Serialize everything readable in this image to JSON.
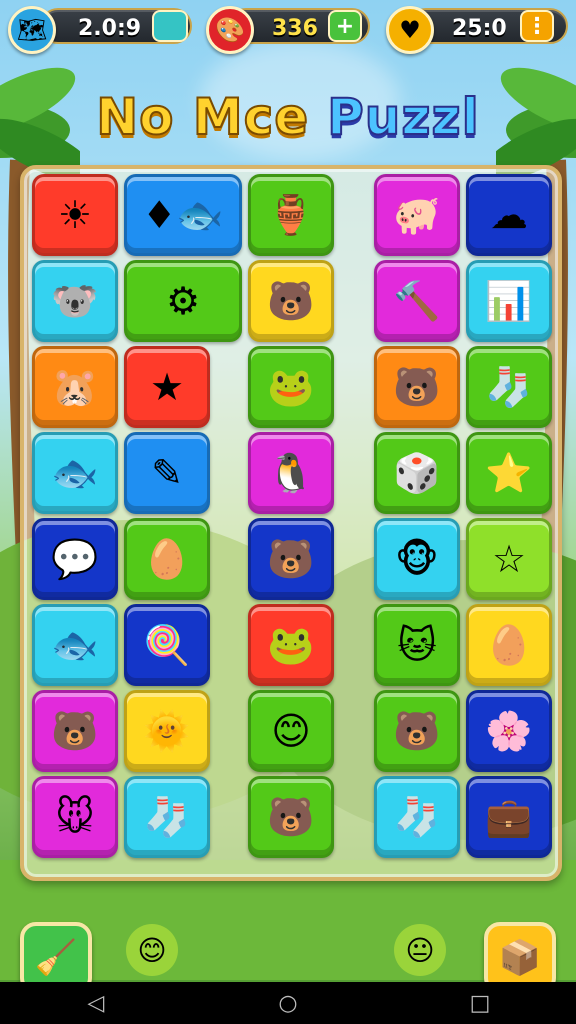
{
  "hud": {
    "left": {
      "icon": "map-globe-icon",
      "value": "2.0:9"
    },
    "middle": {
      "icon": "tools-icon",
      "value": "336",
      "action": "+"
    },
    "right": {
      "icon": "heart-coin-icon",
      "value": "25:0",
      "action": "⋮"
    }
  },
  "title": {
    "word1": "No Mce",
    "word2": "Puzzl"
  },
  "tiles": [
    {
      "col": 0,
      "row": 0,
      "color": "red",
      "glyph": "☀",
      "name": "sun-tile"
    },
    {
      "col": 1,
      "row": 0,
      "color": "blue",
      "glyph": "♦🐟",
      "name": "fish-gem-tile",
      "wide": true
    },
    {
      "col": 2,
      "row": 0,
      "color": "green",
      "glyph": "🏺",
      "name": "jar-tile"
    },
    {
      "col": 4,
      "row": 0,
      "color": "magenta",
      "glyph": "🐖",
      "name": "pig-tile"
    },
    {
      "col": 5,
      "row": 0,
      "color": "dblue",
      "glyph": "☁",
      "name": "cloud-tile"
    },
    {
      "col": 0,
      "row": 1,
      "color": "cyan",
      "glyph": "🐨",
      "name": "koala-tile"
    },
    {
      "col": 1,
      "row": 1,
      "color": "green",
      "glyph": "⚙",
      "name": "tube-tile",
      "wide": true
    },
    {
      "col": 2,
      "row": 1,
      "color": "yellow",
      "glyph": "🐻",
      "name": "bear-tile"
    },
    {
      "col": 4,
      "row": 1,
      "color": "magenta",
      "glyph": "🔨",
      "name": "hammer-tile"
    },
    {
      "col": 5,
      "row": 1,
      "color": "cyan",
      "glyph": "📊",
      "name": "bars-tile"
    },
    {
      "col": 0,
      "row": 2,
      "color": "orange",
      "glyph": "🐹",
      "name": "hamster-tile"
    },
    {
      "col": 1,
      "row": 2,
      "color": "red",
      "glyph": "★",
      "name": "star-tile"
    },
    {
      "col": 2,
      "row": 2,
      "color": "green",
      "glyph": "🐸",
      "name": "frog-tile"
    },
    {
      "col": 4,
      "row": 2,
      "color": "orange",
      "glyph": "🐻",
      "name": "bear-tile"
    },
    {
      "col": 5,
      "row": 2,
      "color": "green",
      "glyph": "🧦",
      "name": "sock-tile"
    },
    {
      "col": 0,
      "row": 3,
      "color": "cyan",
      "glyph": "🐟",
      "name": "fish-tile"
    },
    {
      "col": 1,
      "row": 3,
      "color": "blue",
      "glyph": "✎",
      "name": "brush-tile"
    },
    {
      "col": 2,
      "row": 3,
      "color": "magenta",
      "glyph": "🐧",
      "name": "penguin-tile"
    },
    {
      "col": 4,
      "row": 3,
      "color": "green",
      "glyph": "🎲",
      "name": "dice-tile"
    },
    {
      "col": 5,
      "row": 3,
      "color": "green",
      "glyph": "⭐",
      "name": "gold-star-tile"
    },
    {
      "col": 0,
      "row": 4,
      "color": "dblue",
      "glyph": "💬",
      "name": "speech-bubble-tile"
    },
    {
      "col": 1,
      "row": 4,
      "color": "green",
      "glyph": "🥚",
      "name": "egg-tile"
    },
    {
      "col": 2,
      "row": 4,
      "color": "dblue",
      "glyph": "🐻",
      "name": "blue-bear-tile"
    },
    {
      "col": 4,
      "row": 4,
      "color": "cyan",
      "glyph": "🐵",
      "name": "monkey-tile"
    },
    {
      "col": 5,
      "row": 4,
      "color": "lime",
      "glyph": "☆",
      "name": "white-star-tile"
    },
    {
      "col": 0,
      "row": 5,
      "color": "cyan",
      "glyph": "🐟",
      "name": "blue-fish-tile"
    },
    {
      "col": 1,
      "row": 5,
      "color": "dblue",
      "glyph": "🍭",
      "name": "lollipop-tile"
    },
    {
      "col": 2,
      "row": 5,
      "color": "red",
      "glyph": "🐸",
      "name": "green-frog-tile"
    },
    {
      "col": 4,
      "row": 5,
      "color": "green",
      "glyph": "🐱",
      "name": "cat-tile"
    },
    {
      "col": 5,
      "row": 5,
      "color": "yellow",
      "glyph": "🥚",
      "name": "orange-egg-tile"
    },
    {
      "col": 0,
      "row": 6,
      "color": "magenta",
      "glyph": "🐻",
      "name": "teddy-tile"
    },
    {
      "col": 1,
      "row": 6,
      "color": "yellow",
      "glyph": "🌞",
      "name": "smiling-sun-tile"
    },
    {
      "col": 2,
      "row": 6,
      "color": "green",
      "glyph": "😊",
      "name": "yellow-blob-tile"
    },
    {
      "col": 4,
      "row": 6,
      "color": "green",
      "glyph": "🐻",
      "name": "cub-tile"
    },
    {
      "col": 5,
      "row": 6,
      "color": "dblue",
      "glyph": "🌸",
      "name": "flower-tile"
    },
    {
      "col": 0,
      "row": 7,
      "color": "magenta",
      "glyph": "🐭",
      "name": "mouse-tile"
    },
    {
      "col": 1,
      "row": 7,
      "color": "cyan",
      "glyph": "🧦",
      "name": "blue-sock-tile"
    },
    {
      "col": 2,
      "row": 7,
      "color": "green",
      "glyph": "🐻",
      "name": "brown-bear-tile"
    },
    {
      "col": 4,
      "row": 7,
      "color": "cyan",
      "glyph": "🧦",
      "name": "stocking-tile"
    },
    {
      "col": 5,
      "row": 7,
      "color": "dblue",
      "glyph": "💼",
      "name": "suitcase-tile"
    }
  ],
  "bottom": {
    "left_icon": "sweep-broom-icon",
    "right_icon": "box-icon"
  },
  "navbar": {
    "back": "◁",
    "home": "○",
    "recents": "□"
  }
}
